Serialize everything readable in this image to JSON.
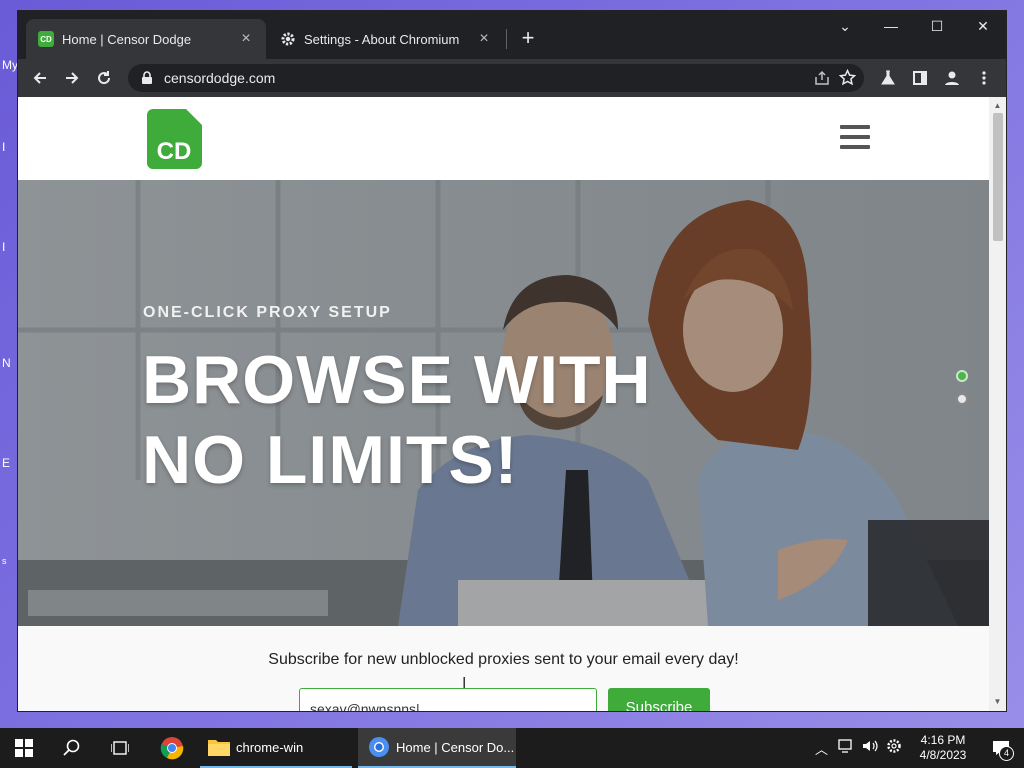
{
  "desktop": {
    "fragments": [
      "My",
      "I",
      "I",
      "N",
      "E",
      "s"
    ]
  },
  "browser": {
    "tabs": [
      {
        "title": "Home | Censor Dodge",
        "active": true,
        "icon": "cd-favicon"
      },
      {
        "title": "Settings - About Chromium",
        "active": false,
        "icon": "gear-icon"
      }
    ],
    "new_tab_label": "+",
    "url": "censordodge.com",
    "window_controls": {
      "dropdown": "⌄",
      "minimize": "—",
      "maximize": "☐",
      "close": "✕"
    }
  },
  "site": {
    "logo_text": "CD",
    "hero": {
      "eyebrow": "ONE-CLICK PROXY SETUP",
      "headline_line1": "BROWSE WITH",
      "headline_line2": "NO LIMITS!",
      "slides": 2,
      "active_slide": 1
    },
    "subscribe": {
      "text": "Subscribe for new unblocked proxies sent to your email every day!",
      "email_value": "sexav@nwnsnns",
      "button_label": "Subscribe"
    }
  },
  "taskbar": {
    "items": [
      {
        "label": "",
        "icon": "chrome-icon"
      },
      {
        "label": "chrome-win",
        "icon": "folder-icon"
      },
      {
        "label": "Home | Censor Do...",
        "icon": "chromium-icon"
      }
    ],
    "time": "4:16 PM",
    "date": "4/8/2023",
    "notification_count": "4"
  },
  "colors": {
    "brand_green": "#3eab3a",
    "tab_bg": "#202124",
    "toolbar_bg": "#35363a",
    "taskbar_bg": "#1c1c1c"
  }
}
